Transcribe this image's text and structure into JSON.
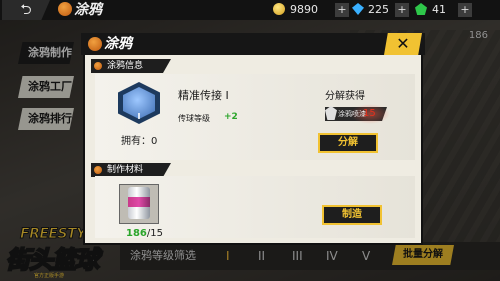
{
  "topbar": {
    "back_icon": "back-arrow-icon",
    "title": "涂鸦",
    "coins": "9890",
    "gems": "225",
    "tokens": "41"
  },
  "sidebar": {
    "items": [
      {
        "label": "涂鸦制作"
      },
      {
        "label": "涂鸦工厂"
      },
      {
        "label": "涂鸦排行"
      }
    ]
  },
  "background": {
    "counter": "186"
  },
  "modal": {
    "title": "涂鸦",
    "close_label": "✕",
    "info_section": "涂鸦信息",
    "badge_level": "I",
    "owned": "拥有：0",
    "skill_name": "精准传接 I",
    "skill_stat": "传球等级",
    "skill_bonus": "+2",
    "decompose_title": "分解获得",
    "decompose_item": "涂鸦喷漆",
    "decompose_qty": "15",
    "decompose_button": "分解",
    "material_section": "制作材料",
    "material_have": "186",
    "material_total": "/15",
    "make_button": "制造"
  },
  "bottom": {
    "filter_label": "涂鸦等级筛选",
    "levels": [
      "I",
      "II",
      "III",
      "IV",
      "V"
    ],
    "batch_button": "批量分解"
  },
  "logo": {
    "top": "FREESTYLE",
    "main": "街头篮球",
    "sub": "官方正版手游"
  },
  "colors": {
    "accent_yellow": "#f1c232",
    "header_black": "#161616",
    "panel_bg": "#efece2",
    "green": "#2aa52a",
    "red": "#e8301c"
  }
}
